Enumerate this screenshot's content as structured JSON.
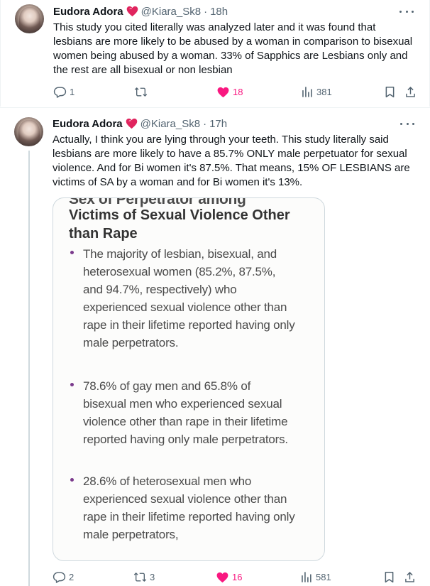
{
  "tweets": [
    {
      "author_name": "Eudora Adora",
      "handle": "@Kiara_Sk8",
      "separator": "·",
      "time": "18h",
      "text": "This study you cited literally was analyzed later and it was found that lesbians are more likely to be abused by a woman in comparison to bisexual women being abused by a woman. 33% of Sapphics are Lesbians only and the rest are all bisexual or non lesbian",
      "replies": "1",
      "reposts": "",
      "likes": "18",
      "views": "381"
    },
    {
      "author_name": "Eudora Adora",
      "handle": "@Kiara_Sk8",
      "separator": "·",
      "time": "17h",
      "text": "Actually, I think you are lying through your teeth. This study literally said lesbians are more likely to have a 85.7% ONLY male perpetuator for sexual violence. And for Bi women it's 87.5%. That means, 15% OF LESBIANS are victims of SA by a woman and for Bi women it's 13%.",
      "replies": "2",
      "reposts": "3",
      "likes": "16",
      "views": "581",
      "image": {
        "title_cut": "Sex of Perpetrator among",
        "title": "Victims of Sexual Violence Other than Rape",
        "bullets": [
          "The majority of lesbian, bisexual, and heterosexual women (85.2%, 87.5%, and 94.7%, respectively) who experienced sexual violence other than rape in their lifetime reported having only male perpetrators.",
          "78.6% of gay men and 65.8% of bisexual men who experienced sexual violence other than rape in their lifetime reported having only male perpetrators.",
          "28.6% of heterosexual men who experienced sexual violence other than rape in their lifetime reported having only male perpetrators,"
        ]
      }
    }
  ],
  "icons": {
    "verified_heart": "red-heart-badge-icon",
    "more": "more-icon",
    "reply": "reply-icon",
    "repost": "repost-icon",
    "like": "like-icon",
    "views": "views-icon",
    "bookmark": "bookmark-icon",
    "share": "share-icon"
  },
  "colors": {
    "like_active": "#f91880",
    "repost_green": "#00ba7c",
    "secondary_text": "#536471",
    "bullet_purple": "#7a3a8c"
  }
}
